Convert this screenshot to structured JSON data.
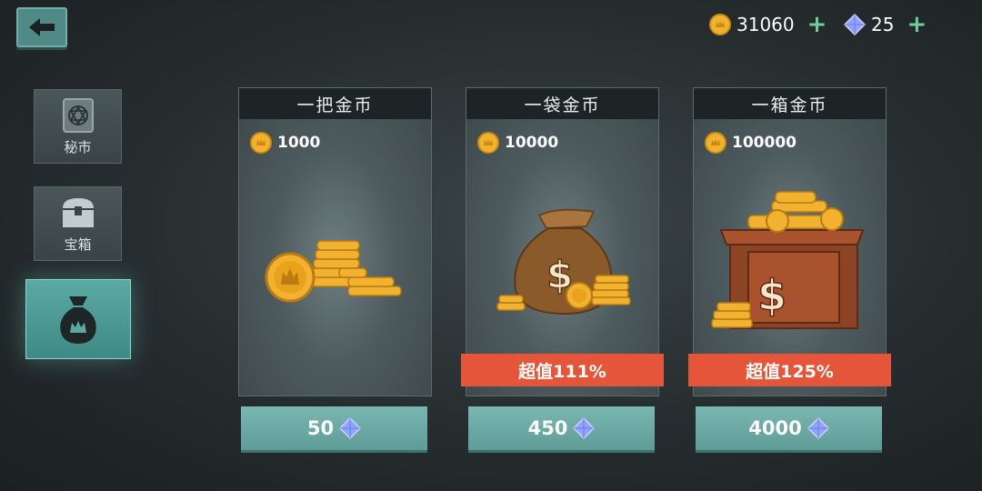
{
  "header": {
    "coins": "31060",
    "gems": "25"
  },
  "sidebar": {
    "items": [
      {
        "label": "秘市"
      },
      {
        "label": "宝箱"
      },
      {
        "label": ""
      }
    ]
  },
  "offers": [
    {
      "title": "一把金币",
      "amount": "1000",
      "price": "50",
      "badge": ""
    },
    {
      "title": "一袋金币",
      "amount": "10000",
      "price": "450",
      "badge": "超值111%"
    },
    {
      "title": "一箱金币",
      "amount": "100000",
      "price": "4000",
      "badge": "超值125%"
    }
  ],
  "colors": {
    "accent": "#5aaaa3",
    "badge": "#e4553a",
    "gold": "#f2b230",
    "gem": "#8fa3ff"
  }
}
